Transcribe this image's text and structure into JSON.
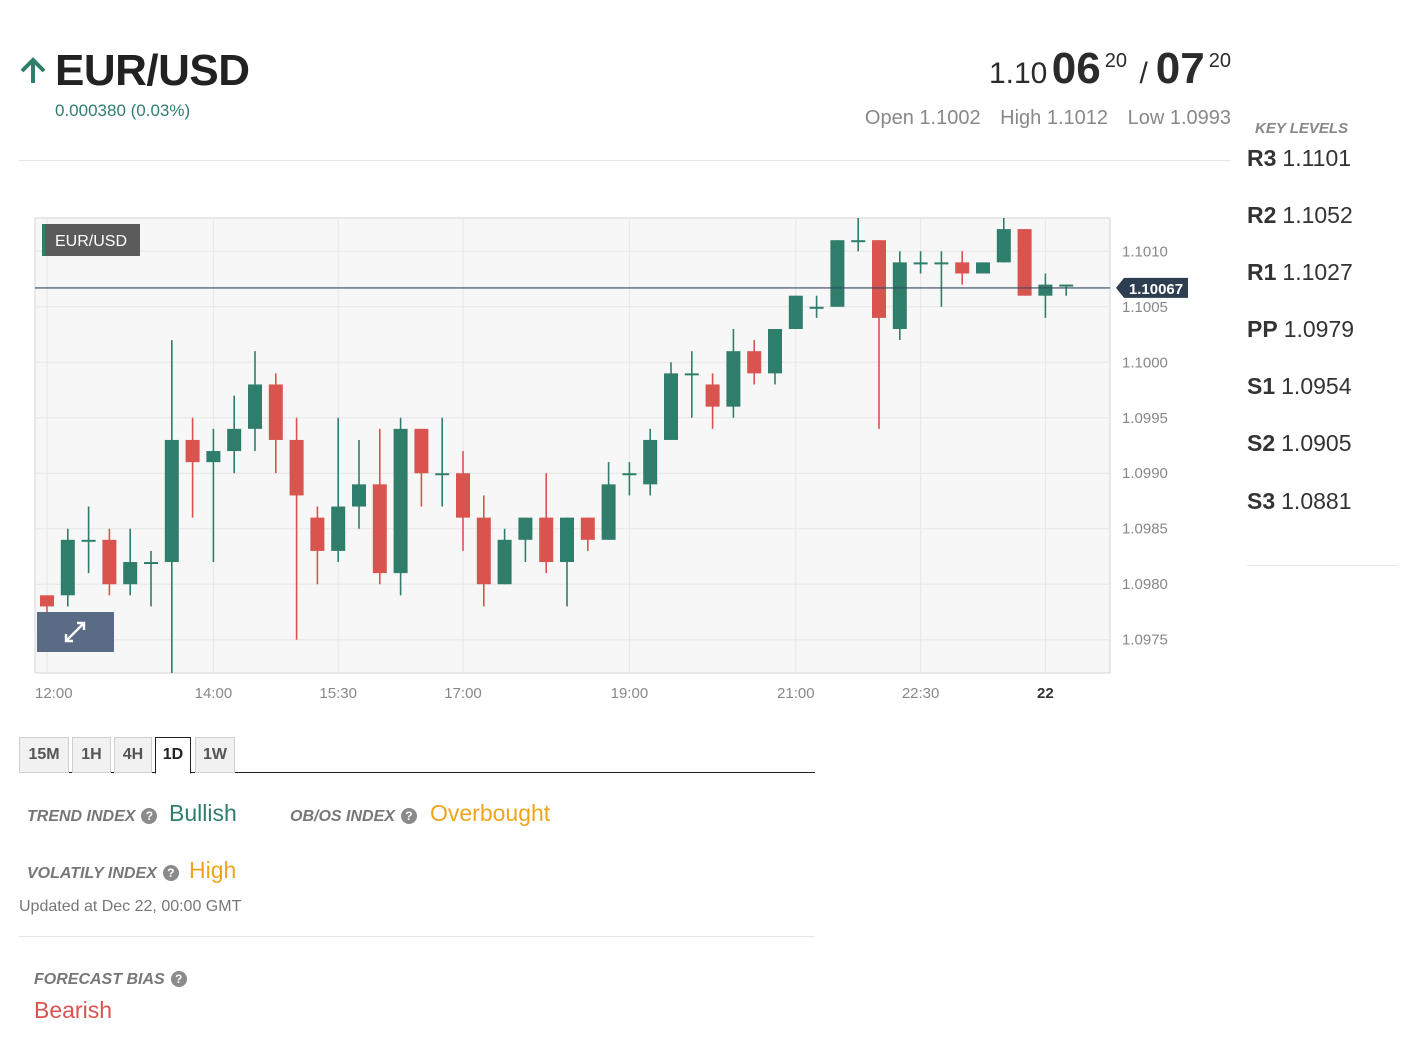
{
  "header": {
    "pair": "EUR/USD",
    "change": "0.000380 (0.03%)",
    "bid_prefix": "1.10",
    "bid_big": "06",
    "bid_sup": "20",
    "separator": "/",
    "ask_big": "07",
    "ask_sup": "20",
    "open": "Open 1.1002",
    "high": "High 1.1012",
    "low": "Low 1.0993",
    "trend_icon": "arrow-up-icon"
  },
  "key_levels": {
    "title": "KEY LEVELS",
    "items": [
      {
        "name": "R3",
        "value": "1.1101"
      },
      {
        "name": "R2",
        "value": "1.1052"
      },
      {
        "name": "R1",
        "value": "1.1027"
      },
      {
        "name": "PP",
        "value": "1.0979"
      },
      {
        "name": "S1",
        "value": "1.0954"
      },
      {
        "name": "S2",
        "value": "1.0905"
      },
      {
        "name": "S3",
        "value": "1.0881"
      }
    ]
  },
  "chart_data": {
    "type": "candlestick",
    "symbol_label": "EUR/USD",
    "current_price_label": "1.10067",
    "current_price": 1.10067,
    "ylim": [
      1.0972,
      1.1013
    ],
    "y_ticks": [
      "1.1010",
      "1.1005",
      "1.1000",
      "1.0995",
      "1.0990",
      "1.0985",
      "1.0980",
      "1.0975"
    ],
    "x_ticks": [
      {
        "label": "12:00",
        "index": 0,
        "bold": false
      },
      {
        "label": "14:00",
        "index": 8,
        "bold": false
      },
      {
        "label": "15:30",
        "index": 14,
        "bold": false
      },
      {
        "label": "17:00",
        "index": 20,
        "bold": false
      },
      {
        "label": "19:00",
        "index": 28,
        "bold": false
      },
      {
        "label": "21:00",
        "index": 36,
        "bold": false
      },
      {
        "label": "22:30",
        "index": 42,
        "bold": false
      },
      {
        "label": "22",
        "index": 48,
        "bold": true
      }
    ],
    "colors": {
      "up": "#2f7e6c",
      "down": "#d9534f",
      "price_line": "#34495e",
      "price_tag": "#2c3e50"
    },
    "candles": [
      {
        "o": 1.0979,
        "h": 1.0979,
        "l": 1.0976,
        "c": 1.0978
      },
      {
        "o": 1.0979,
        "h": 1.0985,
        "l": 1.0978,
        "c": 1.0984
      },
      {
        "o": 1.0984,
        "h": 1.0987,
        "l": 1.0981,
        "c": 1.0984
      },
      {
        "o": 1.0984,
        "h": 1.0985,
        "l": 1.0979,
        "c": 1.098
      },
      {
        "o": 1.098,
        "h": 1.0985,
        "l": 1.0979,
        "c": 1.0982
      },
      {
        "o": 1.0982,
        "h": 1.0983,
        "l": 1.0978,
        "c": 1.0982
      },
      {
        "o": 1.0982,
        "h": 1.1002,
        "l": 1.0972,
        "c": 1.0993
      },
      {
        "o": 1.0993,
        "h": 1.0995,
        "l": 1.0986,
        "c": 1.0991
      },
      {
        "o": 1.0991,
        "h": 1.0994,
        "l": 1.0982,
        "c": 1.0992
      },
      {
        "o": 1.0992,
        "h": 1.0997,
        "l": 1.099,
        "c": 1.0994
      },
      {
        "o": 1.0994,
        "h": 1.1001,
        "l": 1.0992,
        "c": 1.0998
      },
      {
        "o": 1.0998,
        "h": 1.0999,
        "l": 1.099,
        "c": 1.0993
      },
      {
        "o": 1.0993,
        "h": 1.0995,
        "l": 1.0975,
        "c": 1.0988
      },
      {
        "o": 1.0986,
        "h": 1.0987,
        "l": 1.098,
        "c": 1.0983
      },
      {
        "o": 1.0983,
        "h": 1.0995,
        "l": 1.0982,
        "c": 1.0987
      },
      {
        "o": 1.0987,
        "h": 1.0993,
        "l": 1.0985,
        "c": 1.0989
      },
      {
        "o": 1.0989,
        "h": 1.0994,
        "l": 1.098,
        "c": 1.0981
      },
      {
        "o": 1.0981,
        "h": 1.0995,
        "l": 1.0979,
        "c": 1.0994
      },
      {
        "o": 1.0994,
        "h": 1.0994,
        "l": 1.0987,
        "c": 1.099
      },
      {
        "o": 1.099,
        "h": 1.0995,
        "l": 1.0987,
        "c": 1.099
      },
      {
        "o": 1.099,
        "h": 1.0992,
        "l": 1.0983,
        "c": 1.0986
      },
      {
        "o": 1.0986,
        "h": 1.0988,
        "l": 1.0978,
        "c": 1.098
      },
      {
        "o": 1.098,
        "h": 1.0985,
        "l": 1.098,
        "c": 1.0984
      },
      {
        "o": 1.0984,
        "h": 1.0986,
        "l": 1.0982,
        "c": 1.0986
      },
      {
        "o": 1.0986,
        "h": 1.099,
        "l": 1.0981,
        "c": 1.0982
      },
      {
        "o": 1.0982,
        "h": 1.0986,
        "l": 1.0978,
        "c": 1.0986
      },
      {
        "o": 1.0986,
        "h": 1.0986,
        "l": 1.0983,
        "c": 1.0984
      },
      {
        "o": 1.0984,
        "h": 1.0991,
        "l": 1.0984,
        "c": 1.0989
      },
      {
        "o": 1.099,
        "h": 1.0991,
        "l": 1.0988,
        "c": 1.099
      },
      {
        "o": 1.0989,
        "h": 1.0994,
        "l": 1.0988,
        "c": 1.0993
      },
      {
        "o": 1.0993,
        "h": 1.1,
        "l": 1.0993,
        "c": 1.0999
      },
      {
        "o": 1.0999,
        "h": 1.1001,
        "l": 1.0995,
        "c": 1.0999
      },
      {
        "o": 1.0998,
        "h": 1.0999,
        "l": 1.0994,
        "c": 1.0996
      },
      {
        "o": 1.0996,
        "h": 1.1003,
        "l": 1.0995,
        "c": 1.1001
      },
      {
        "o": 1.1001,
        "h": 1.1002,
        "l": 1.0998,
        "c": 1.0999
      },
      {
        "o": 1.0999,
        "h": 1.1003,
        "l": 1.0998,
        "c": 1.1003
      },
      {
        "o": 1.1003,
        "h": 1.1006,
        "l": 1.1003,
        "c": 1.1006
      },
      {
        "o": 1.1005,
        "h": 1.1006,
        "l": 1.1004,
        "c": 1.1005
      },
      {
        "o": 1.1005,
        "h": 1.1011,
        "l": 1.1005,
        "c": 1.1011
      },
      {
        "o": 1.1011,
        "h": 1.1013,
        "l": 1.101,
        "c": 1.1011
      },
      {
        "o": 1.1011,
        "h": 1.1011,
        "l": 1.0994,
        "c": 1.1004
      },
      {
        "o": 1.1003,
        "h": 1.101,
        "l": 1.1002,
        "c": 1.1009
      },
      {
        "o": 1.1009,
        "h": 1.101,
        "l": 1.1008,
        "c": 1.1009
      },
      {
        "o": 1.1009,
        "h": 1.101,
        "l": 1.1005,
        "c": 1.1009
      },
      {
        "o": 1.1009,
        "h": 1.101,
        "l": 1.1007,
        "c": 1.1008
      },
      {
        "o": 1.1008,
        "h": 1.1009,
        "l": 1.1008,
        "c": 1.1009
      },
      {
        "o": 1.1009,
        "h": 1.1013,
        "l": 1.1009,
        "c": 1.1012
      },
      {
        "o": 1.1012,
        "h": 1.1012,
        "l": 1.1006,
        "c": 1.1006
      },
      {
        "o": 1.1006,
        "h": 1.1008,
        "l": 1.1004,
        "c": 1.1007
      },
      {
        "o": 1.1007,
        "h": 1.1007,
        "l": 1.1006,
        "c": 1.1007
      }
    ]
  },
  "timeframes": {
    "tabs": [
      "15M",
      "1H",
      "4H",
      "1D",
      "1W"
    ],
    "active": "1D"
  },
  "indices": {
    "trend_label": "TREND INDEX",
    "trend_value": "Bullish",
    "obos_label": "OB/OS INDEX",
    "obos_value": "Overbought",
    "volatility_label": "VOLATILY INDEX",
    "volatility_value": "High",
    "updated": "Updated at Dec 22, 00:00 GMT",
    "help_icon": "question-circle-icon"
  },
  "forecast": {
    "label": "FORECAST BIAS",
    "value": "Bearish"
  }
}
